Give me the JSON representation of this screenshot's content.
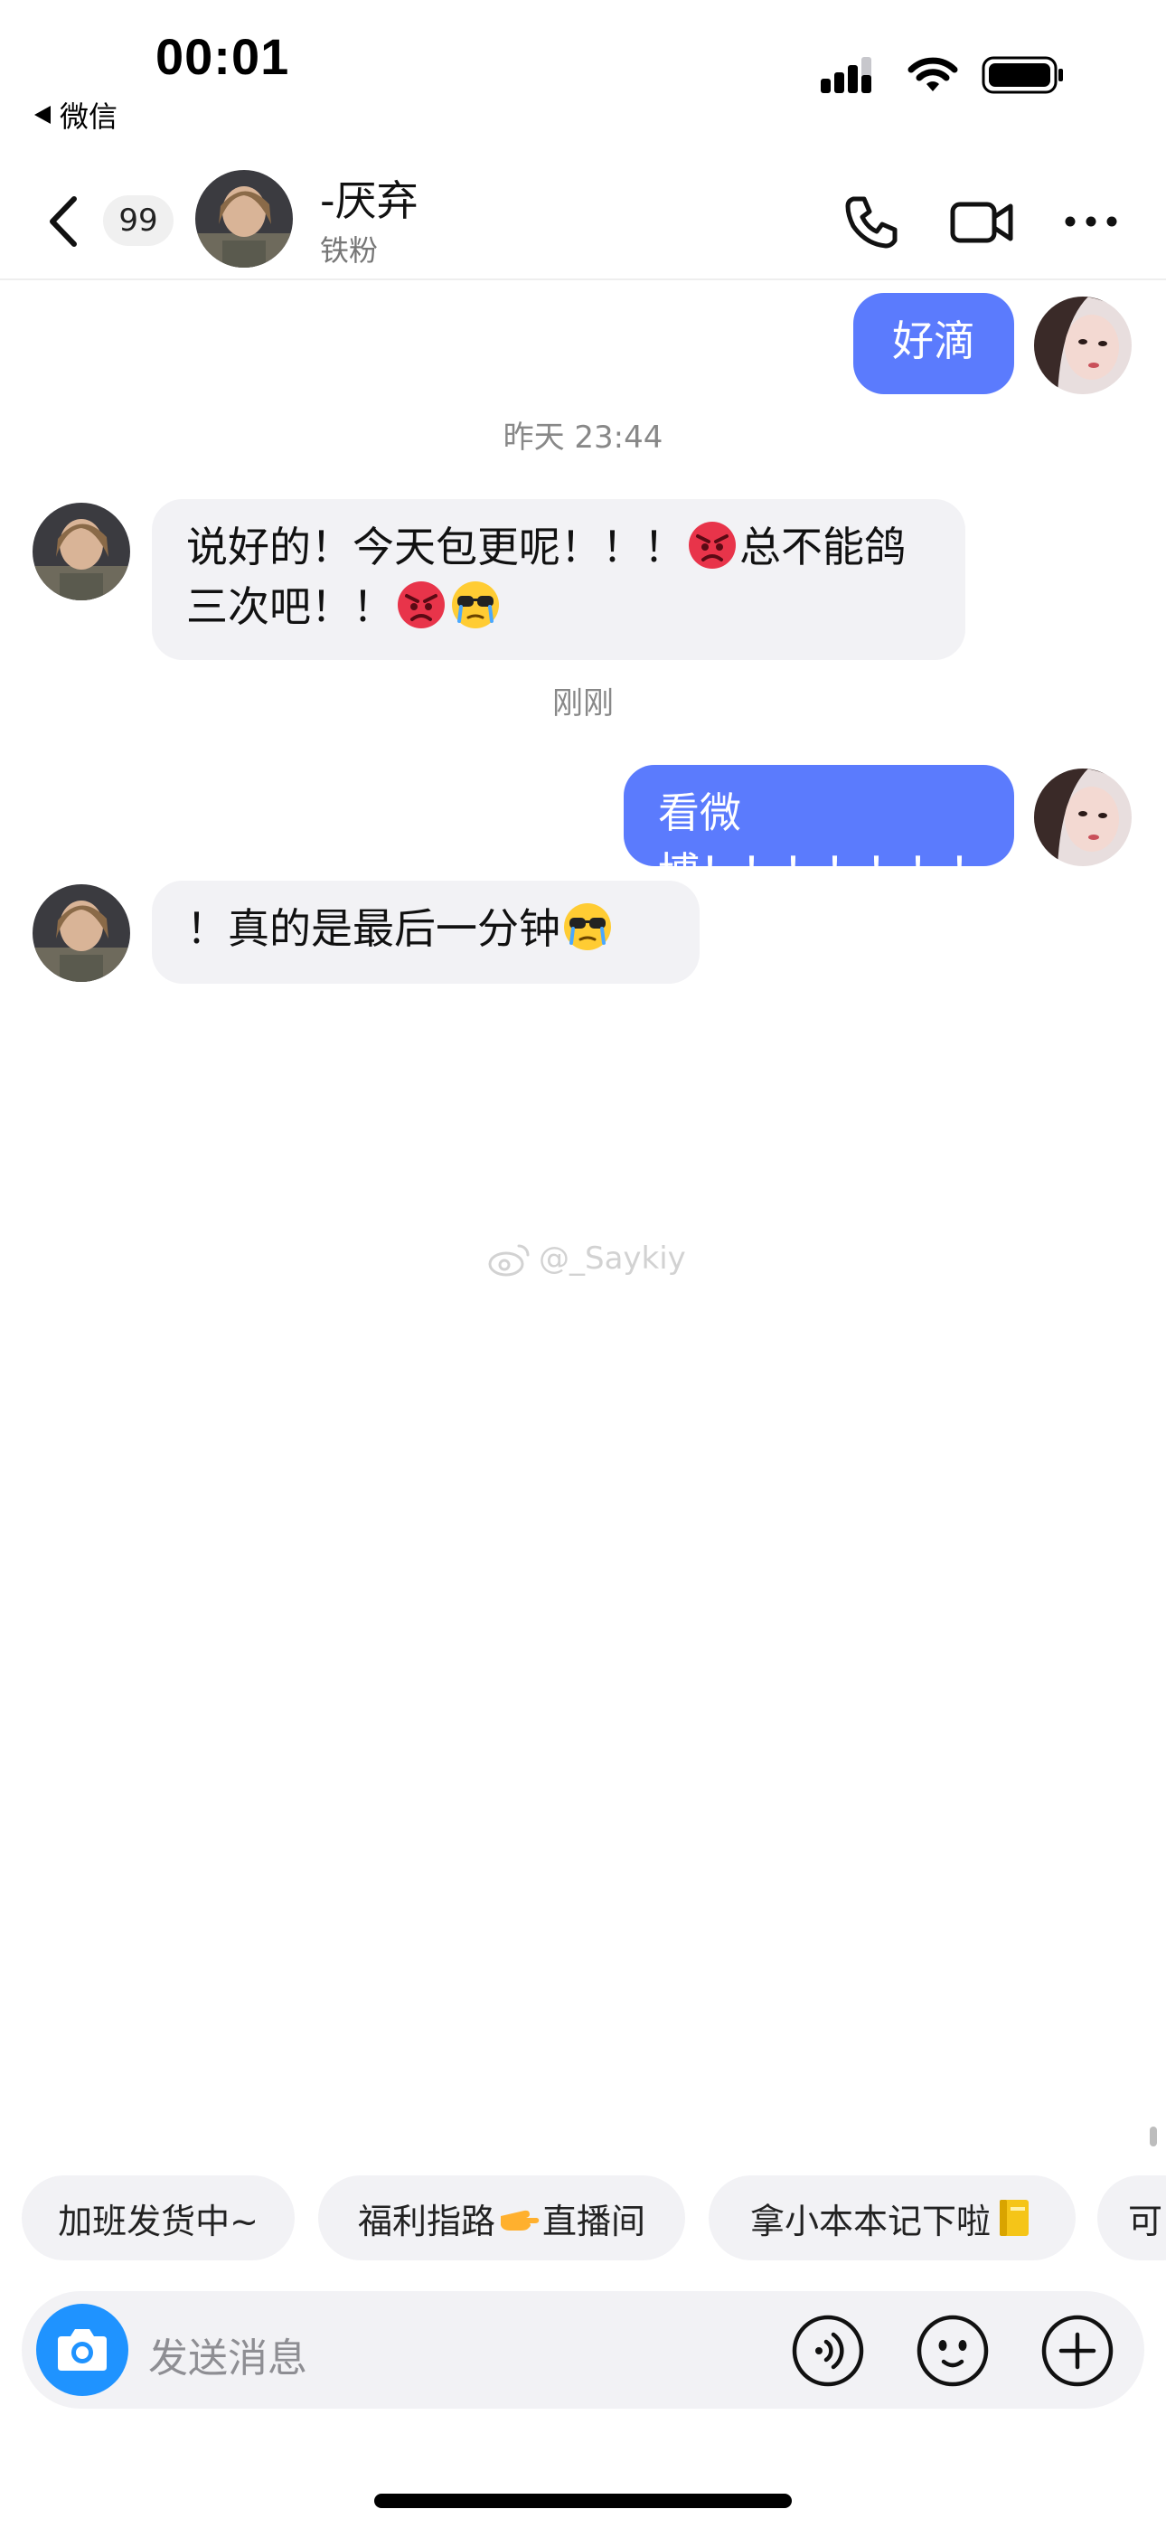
{
  "status_bar": {
    "time": "00:01",
    "back_app": "微信"
  },
  "header": {
    "unread_count": "99",
    "contact_name": "-厌弃",
    "contact_subtitle": "铁粉"
  },
  "messages": [
    {
      "type": "out",
      "text": "好滴"
    },
    {
      "type": "time",
      "text": "昨天 23:44"
    },
    {
      "type": "in",
      "line1": "说好的！今天包更呢！！！",
      "line1_after": "总不能鸽",
      "line2": "三次吧！！"
    },
    {
      "type": "time",
      "text": "刚刚"
    },
    {
      "type": "out",
      "text": "看微博！！！！！！！"
    },
    {
      "type": "in",
      "text": "！真的是最后一分钟"
    }
  ],
  "watermark": "@_Saykiy",
  "quick_replies": [
    "加班发货中~",
    "福利指路",
    "直播间",
    "拿小本本记下啦",
    "可"
  ],
  "input": {
    "placeholder": "发送消息"
  },
  "colors": {
    "outgoing_bubble": "#5b7bfd",
    "incoming_bubble": "#f2f2f5",
    "camera_button": "#1f93ff"
  },
  "icons": {
    "back": "chevron-left-icon",
    "call": "phone-icon",
    "video": "video-camera-icon",
    "more": "more-dots-icon",
    "camera": "camera-icon",
    "voice": "voice-icon",
    "emoji": "emoji-face-icon",
    "add": "plus-circle-icon"
  }
}
